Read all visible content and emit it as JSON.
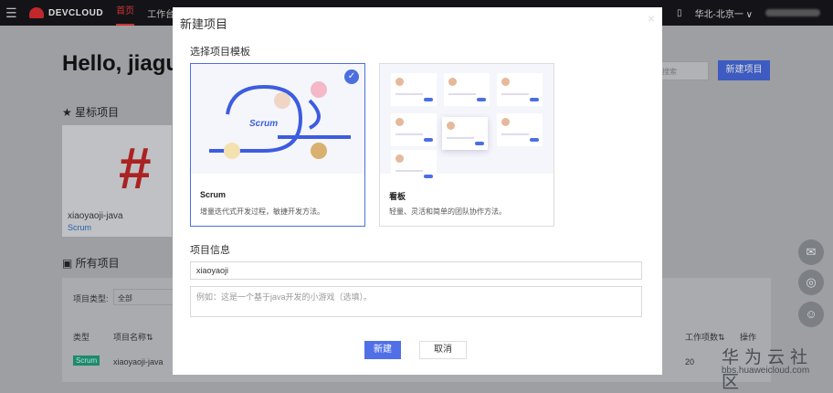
{
  "topbar": {
    "brand": "DEVCLOUD",
    "nav": [
      "首页",
      "工作台"
    ],
    "region": "华北-北京一 ∨"
  },
  "page": {
    "greeting": "Hello, jiagu",
    "starred_title": "星标项目",
    "all_title": "所有项目",
    "search_placeholder": "搜索",
    "new_project": "新建项目",
    "starred_card": {
      "name": "xiaoyaoji-java",
      "type": "Scrum"
    },
    "filter_label": "项目类型:",
    "filter_value": "全部",
    "columns": [
      "类型",
      "项目名称⇅",
      "工作项数⇅",
      "操作"
    ],
    "rows": [
      {
        "type": "Scrum",
        "name": "xiaoyaoji-java",
        "work_items": "20"
      }
    ]
  },
  "watermark": {
    "cn": "华为云社区",
    "url": "bbs.huaweicloud.com"
  },
  "modal": {
    "title": "新建项目",
    "close": "×",
    "template_label": "选择项目模板",
    "templates": [
      {
        "name": "Scrum",
        "desc": "增量迭代式开发过程，敏捷开发方法。",
        "art_text": "Scrum",
        "selected": true
      },
      {
        "name": "看板",
        "desc": "轻量、灵活和简单的团队协作方法。",
        "selected": false
      }
    ],
    "info_label": "项目信息",
    "name_value": "xiaoyaoji",
    "desc_placeholder": "例如：这是一个基于java开发的小游戏（选填）。",
    "create": "新建",
    "cancel": "取消"
  }
}
